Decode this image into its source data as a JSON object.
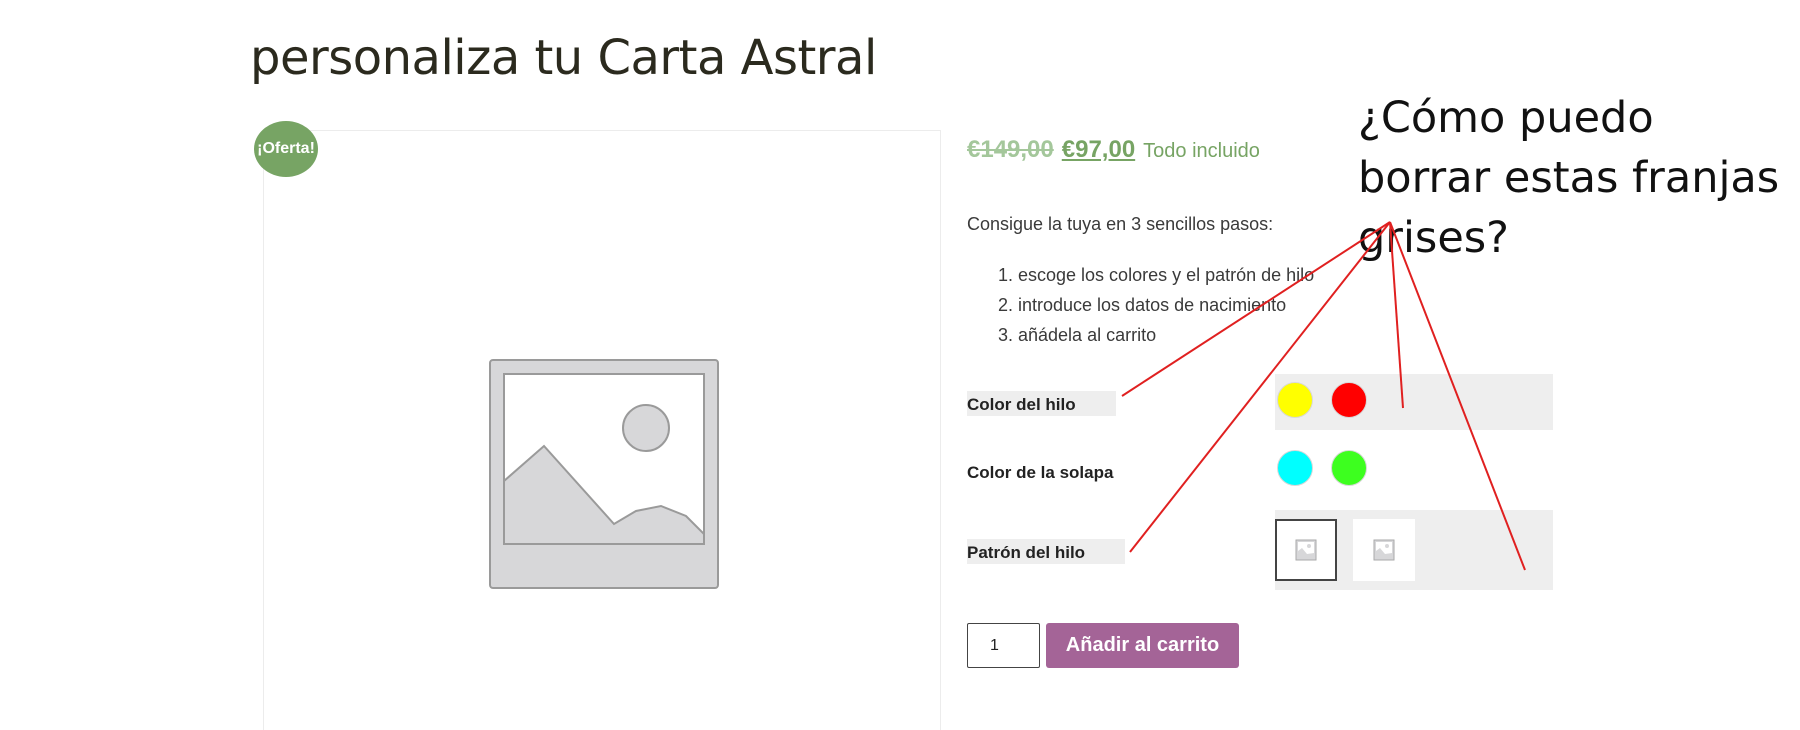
{
  "product": {
    "title": "personaliza tu Carta Astral",
    "sale_badge": "¡Oferta!",
    "price_old": "€149,00",
    "price_new": "€97,00",
    "price_suffix": "Todo incluido",
    "intro": "Consigue la tuya en 3 sencillos pasos:",
    "steps": [
      "escoge los colores y el patrón de hilo",
      "introduce los datos de nacimiento",
      "añádela al carrito"
    ]
  },
  "variations": {
    "thread_color": {
      "label": "Color del hilo",
      "options": [
        {
          "name": "yellow",
          "color": "#ffff00"
        },
        {
          "name": "red",
          "color": "#ff0000"
        }
      ]
    },
    "flap_color": {
      "label": "Color de la solapa",
      "options": [
        {
          "name": "cyan",
          "color": "#00ffff"
        },
        {
          "name": "green",
          "color": "#3dff1f"
        }
      ]
    },
    "thread_pattern": {
      "label": "Patrón del hilo",
      "options": [
        {
          "name": "pattern-1",
          "selected": true
        },
        {
          "name": "pattern-2",
          "selected": false
        }
      ]
    }
  },
  "cart": {
    "quantity": "1",
    "add_to_cart_label": "Añadir al carrito"
  },
  "annotation": {
    "question": "¿Cómo puedo borrar estas franjas grises?",
    "line_color": "#e02020"
  },
  "colors": {
    "accent_green": "#77a464",
    "button_purple": "#a46497",
    "stripe_grey": "#eeeeee"
  }
}
